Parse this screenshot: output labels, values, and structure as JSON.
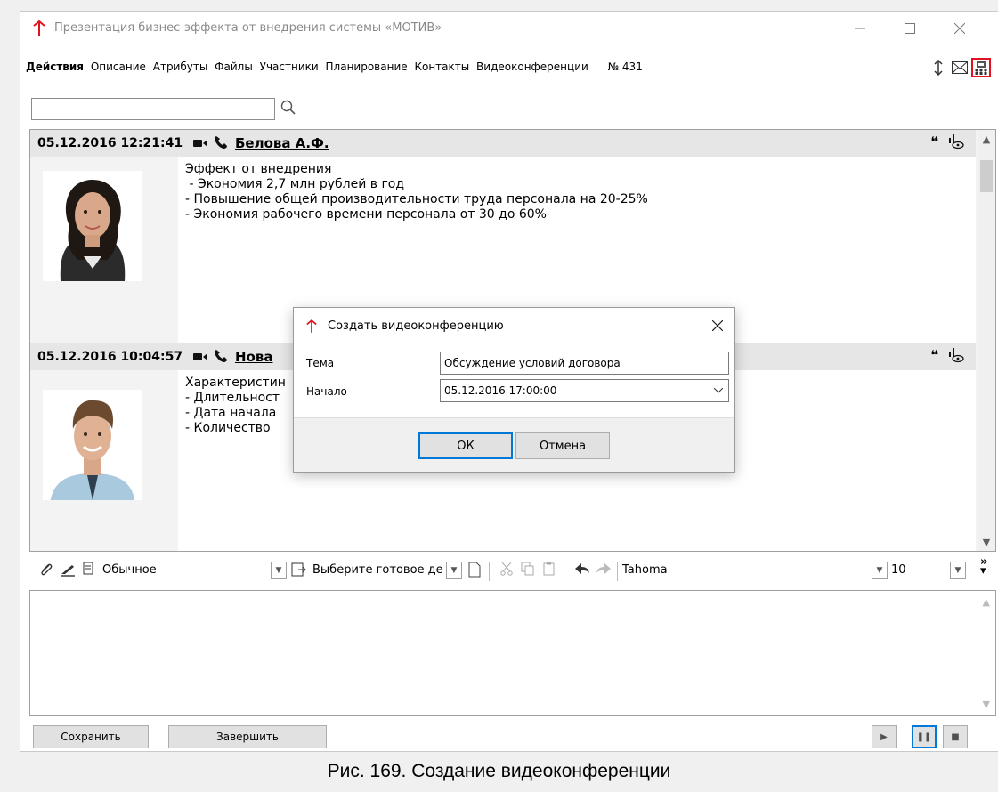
{
  "window": {
    "title": "Презентация бизнес-эффекта от внедрения системы «МОТИВ»"
  },
  "menu": {
    "items": [
      "Действия",
      "Описание",
      "Атрибуты",
      "Файлы",
      "Участники",
      "Планирование",
      "Контакты",
      "Видеоконференции"
    ],
    "doc_number": "№ 431"
  },
  "toolbar": {
    "icons": [
      "sort-icon",
      "mail-icon",
      "videoconference-icon"
    ]
  },
  "search": {
    "value": "",
    "placeholder": ""
  },
  "entries": [
    {
      "datetime": "05.12.2016 12:21:41",
      "author": "Белова А.Ф.",
      "lines": [
        "Эффект от внедрения",
        " - Экономия 2,7 млн рублей в год",
        "- Повышение общей производительности труда персонала на 20-25%",
        "- Экономия рабочего времени персонала от 30 до 60%"
      ]
    },
    {
      "datetime": "05.12.2016 10:04:57",
      "author": "Нова",
      "lines": [
        "Характеристин",
        "- Длительност",
        "- Дата начала",
        "- Количество"
      ]
    }
  ],
  "format_toolbar": {
    "style": "Обычное",
    "template": "Выберите готовое де",
    "font": "Tahoma",
    "size": "10"
  },
  "bottom": {
    "save_label": "Сохранить",
    "finish_label": "Завершить"
  },
  "dialog": {
    "title": "Создать видеоконференцию",
    "topic_label": "Тема",
    "topic_value": "Обсуждение условий договора",
    "start_label": "Начало",
    "start_value": "05.12.2016 17:00:00",
    "ok_label": "ОК",
    "cancel_label": "Отмена"
  },
  "caption": "Рис. 169. Создание видеоконференции",
  "colors": {
    "accent": "#e0141e",
    "focus": "#0078d7"
  }
}
